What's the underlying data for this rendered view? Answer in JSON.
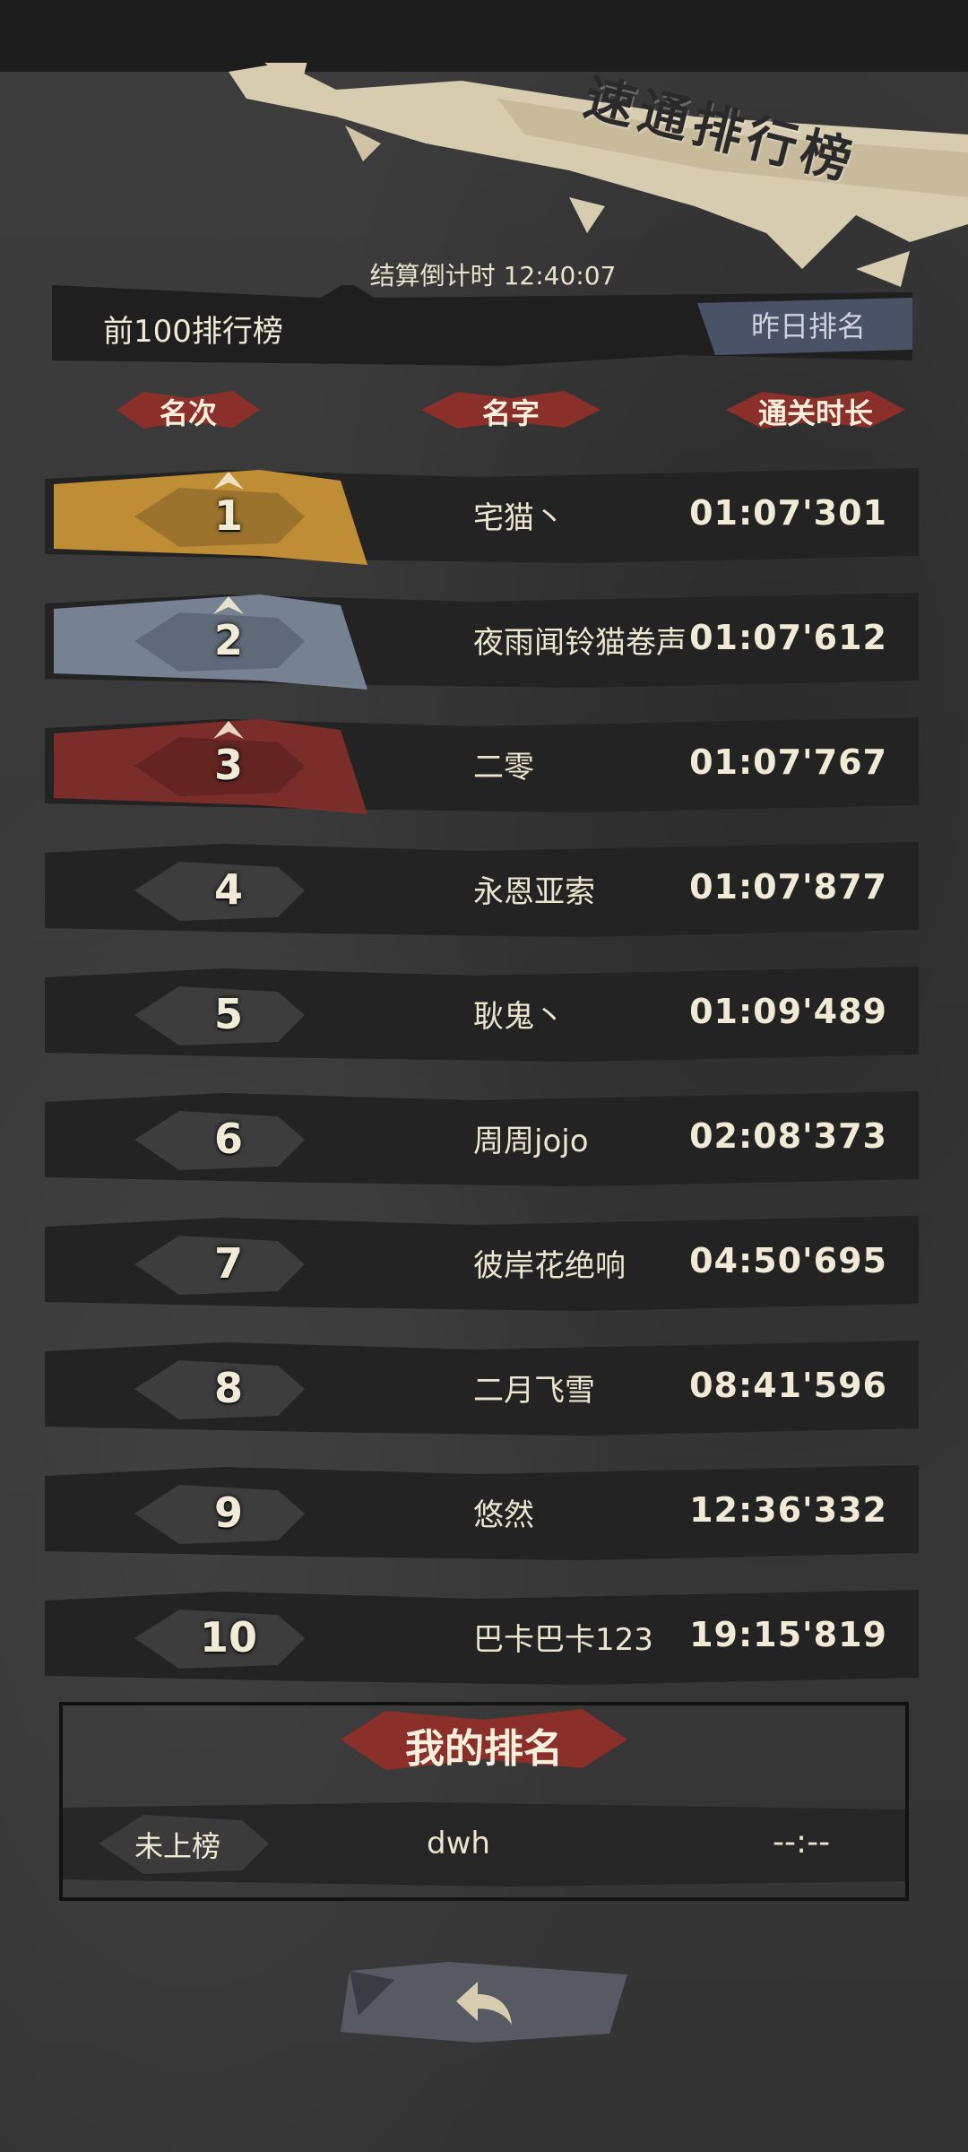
{
  "title": "速通排行榜",
  "countdown": "结算倒计时 12:40:07",
  "list_title": "前100排行榜",
  "yesterday_button": "昨日排名",
  "columns": {
    "rank": "名次",
    "name": "名字",
    "time": "通关时长"
  },
  "rows": [
    {
      "rank": "1",
      "name": "宅猫丶",
      "time": "01:07'301",
      "medal": "gold"
    },
    {
      "rank": "2",
      "name": "夜雨闻铃猫卷声",
      "time": "01:07'612",
      "medal": "silver"
    },
    {
      "rank": "3",
      "name": "二零",
      "time": "01:07'767",
      "medal": "bronze"
    },
    {
      "rank": "4",
      "name": "永恩亚索",
      "time": "01:07'877",
      "medal": "none"
    },
    {
      "rank": "5",
      "name": "耿鬼丶",
      "time": "01:09'489",
      "medal": "none"
    },
    {
      "rank": "6",
      "name": "周周jojo",
      "time": "02:08'373",
      "medal": "none"
    },
    {
      "rank": "7",
      "name": "彼岸花绝响",
      "time": "04:50'695",
      "medal": "none"
    },
    {
      "rank": "8",
      "name": "二月飞雪",
      "time": "08:41'596",
      "medal": "none"
    },
    {
      "rank": "9",
      "name": "悠然",
      "time": "12:36'332",
      "medal": "none"
    },
    {
      "rank": "10",
      "name": "巴卡巴卡123",
      "time": "19:15'819",
      "medal": "none"
    }
  ],
  "my_rank": {
    "title": "我的排名",
    "rank": "未上榜",
    "name": "dwh",
    "time": "--:--"
  },
  "back_icon": "back-arrow-icon",
  "colors": {
    "gold": "#d9a03a",
    "silver": "#8592a6",
    "bronze": "#8a2f2a",
    "accent_red": "#a8392c",
    "banner": "#d8ccb0"
  }
}
